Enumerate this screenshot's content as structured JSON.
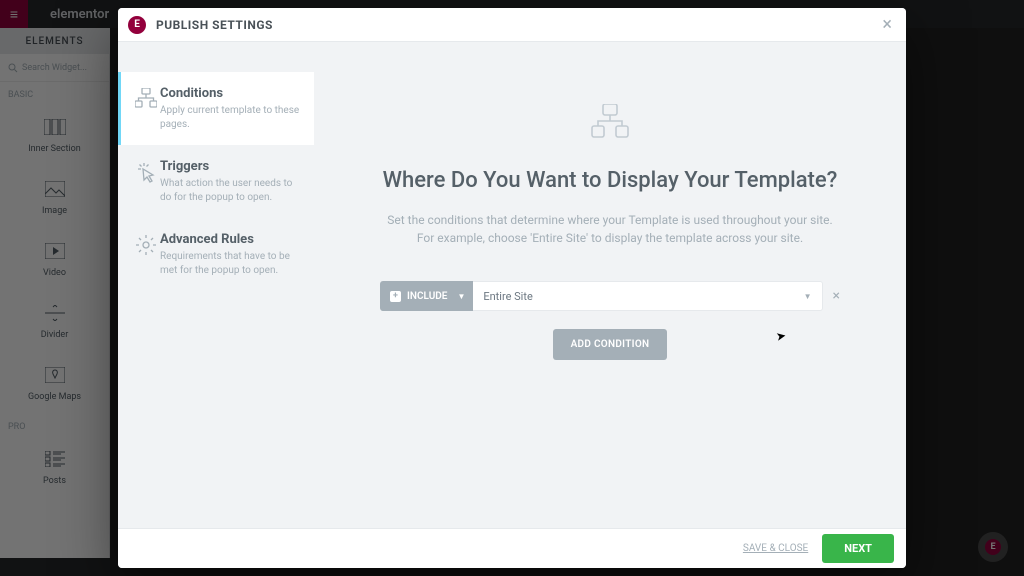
{
  "bg": {
    "brand": "elementor",
    "tab": "ELEMENTS",
    "search_placeholder": "Search Widget...",
    "sections": {
      "basic": "BASIC",
      "pro": "PRO"
    },
    "widgets": {
      "inner_section": "Inner Section",
      "image": "Image",
      "video": "Video",
      "divider": "Divider",
      "google_maps": "Google Maps",
      "posts": "Posts"
    }
  },
  "modal": {
    "title": "PUBLISH SETTINGS",
    "nav": {
      "conditions": {
        "title": "Conditions",
        "desc": "Apply current template to these pages."
      },
      "triggers": {
        "title": "Triggers",
        "desc": "What action the user needs to do for the popup to open."
      },
      "advanced": {
        "title": "Advanced Rules",
        "desc": "Requirements that have to be met for the popup to open."
      }
    },
    "main": {
      "heading": "Where Do You Want to Display Your Template?",
      "sub": "Set the conditions that determine where your Template is used throughout your site. For example, choose 'Entire Site' to display the template across your site.",
      "include_label": "INCLUDE",
      "condition_value": "Entire Site",
      "add_condition": "ADD CONDITION"
    },
    "footer": {
      "save_close": "SAVE & CLOSE",
      "next": "NEXT"
    }
  }
}
